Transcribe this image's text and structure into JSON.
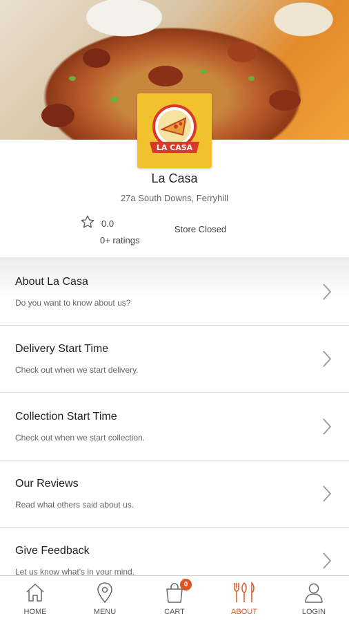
{
  "store": {
    "logo_text": "LA CASA",
    "name": "La Casa",
    "address": "27a South Downs, Ferryhill",
    "rating": "0.0",
    "ratings_count": "0+ ratings",
    "status": "Store Closed"
  },
  "menu_rows": [
    {
      "title": "About La Casa",
      "subtitle": "Do you want to know about us?"
    },
    {
      "title": "Delivery Start Time",
      "subtitle": "Check out when we start delivery."
    },
    {
      "title": "Collection Start Time",
      "subtitle": "Check out when we start collection."
    },
    {
      "title": "Our Reviews",
      "subtitle": "Read what others said about us."
    },
    {
      "title": "Give Feedback",
      "subtitle": "Let us know what's in your mind."
    }
  ],
  "nav": {
    "home": "HOME",
    "menu": "MENU",
    "cart": "CART",
    "cart_badge": "0",
    "about": "ABOUT",
    "login": "LOGIN",
    "active": "about",
    "accent_color": "#e0521f"
  },
  "icons": [
    "star-icon",
    "chevron-right-icon",
    "home-icon",
    "location-pin-icon",
    "shopping-bag-icon",
    "fork-knife-icon",
    "user-icon"
  ]
}
